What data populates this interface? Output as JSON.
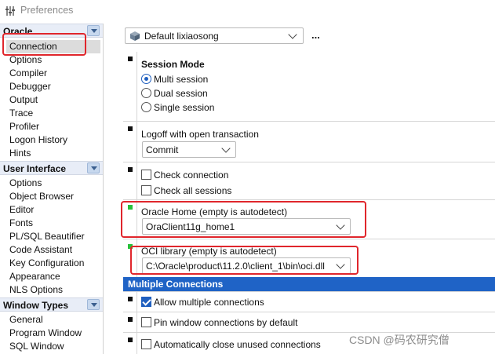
{
  "window": {
    "title": "Preferences"
  },
  "nav": {
    "groups": [
      {
        "label": "Oracle",
        "items": [
          "Connection",
          "Options",
          "Compiler",
          "Debugger",
          "Output",
          "Trace",
          "Profiler",
          "Logon History",
          "Hints"
        ]
      },
      {
        "label": "User Interface",
        "items": [
          "Options",
          "Object Browser",
          "Editor",
          "Fonts",
          "PL/SQL Beautifier",
          "Code Assistant",
          "Key Configuration",
          "Appearance",
          "NLS Options"
        ]
      },
      {
        "label": "Window Types",
        "items": [
          "General",
          "Program Window",
          "SQL Window"
        ]
      }
    ],
    "selected": "Connection"
  },
  "toolbar": {
    "profile": "Default lixiaosong",
    "more_label": "..."
  },
  "session_mode": {
    "title": "Session Mode",
    "options": [
      "Multi session",
      "Dual session",
      "Single session"
    ],
    "selected": "Multi session"
  },
  "logoff": {
    "label": "Logoff with open transaction",
    "value": "Commit"
  },
  "checks": {
    "check_connection": {
      "label": "Check connection",
      "checked": false
    },
    "check_all_sessions": {
      "label": "Check all sessions",
      "checked": false
    }
  },
  "oracle_home": {
    "label": "Oracle Home (empty is autodetect)",
    "value": "OraClient11g_home1"
  },
  "oci_library": {
    "label": "OCI library (empty is autodetect)",
    "value": "C:\\Oracle\\product\\11.2.0\\client_1\\bin\\oci.dll"
  },
  "multiple_connections": {
    "header": "Multiple Connections",
    "allow": {
      "label": "Allow multiple connections",
      "checked": true
    },
    "pin": {
      "label": "Pin window connections by default",
      "checked": false
    },
    "auto_close": {
      "label": "Automatically close unused connections",
      "checked": false
    }
  },
  "watermark": "CSDN @码农研究僧",
  "colors": {
    "selection_blue": "#1f63c6",
    "highlight_red": "#e0262c",
    "marker_green": "#28c03a"
  }
}
